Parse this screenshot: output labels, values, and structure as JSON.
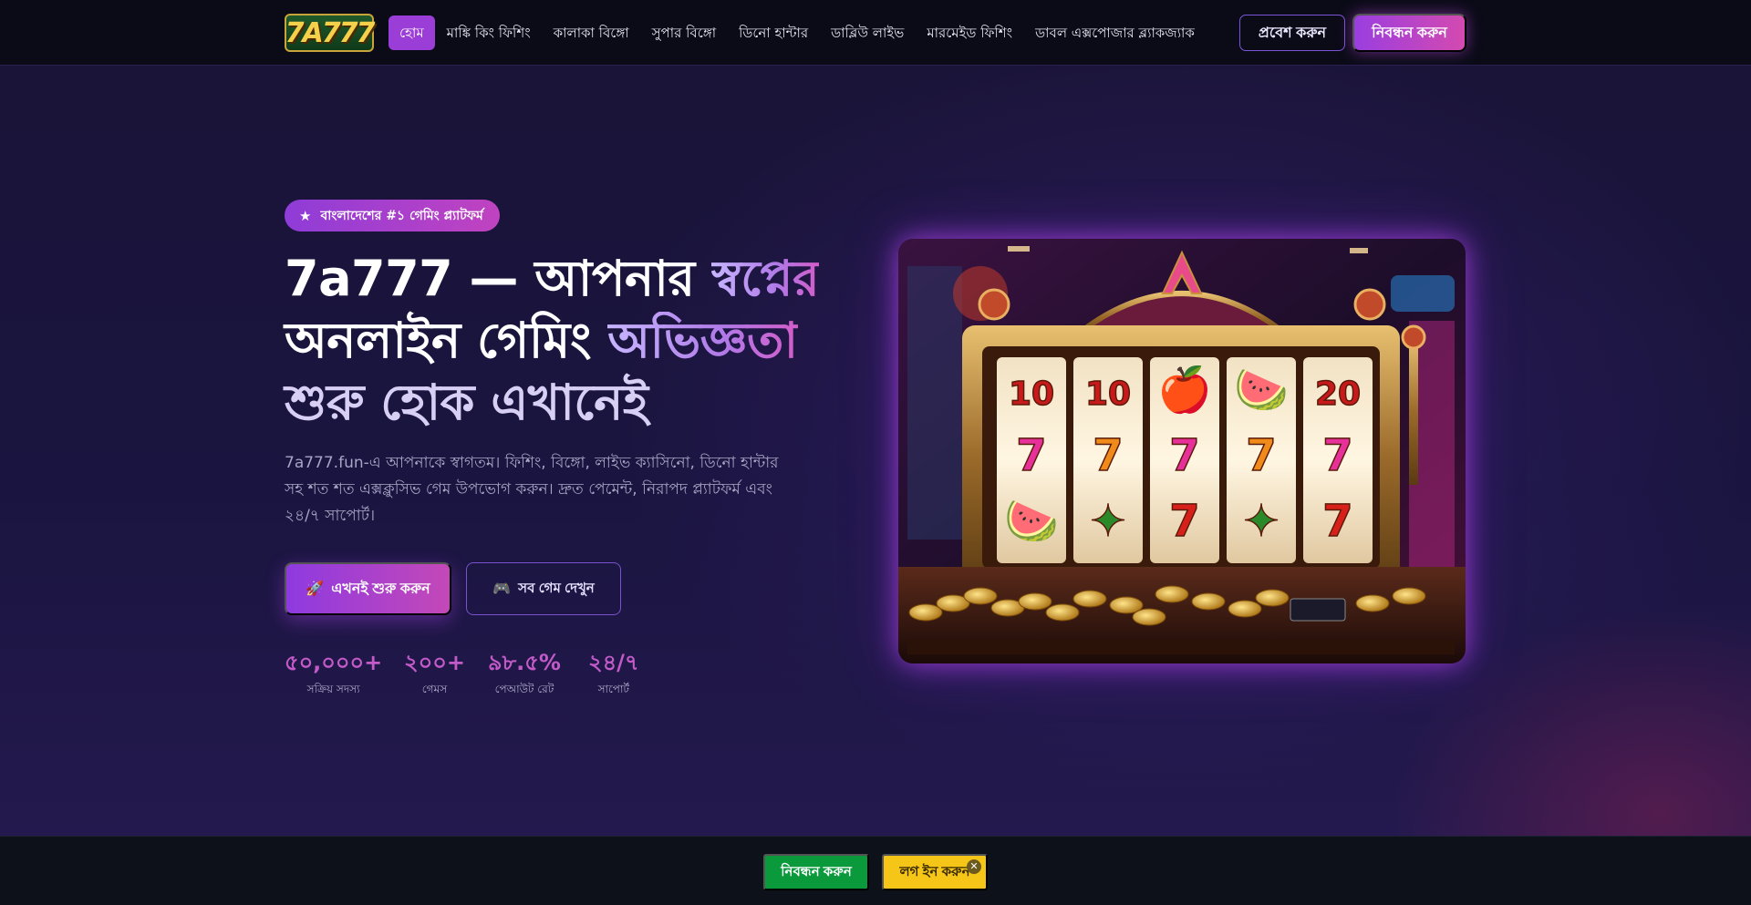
{
  "header": {
    "logo_text": "7A777",
    "nav": [
      {
        "label": "হোম",
        "active": true
      },
      {
        "label": "মাঙ্কি কিং ফিশিং"
      },
      {
        "label": "কালাকা বিঙ্গো"
      },
      {
        "label": "সুপার বিঙ্গো"
      },
      {
        "label": "ডিনো হান্টার"
      },
      {
        "label": "ডাব্লিউ লাইভ"
      },
      {
        "label": "মারমেইড ফিশিং"
      },
      {
        "label": "ডাবল এক্সপোজার ব্ল্যাকজ্যাক"
      }
    ],
    "login_label": "প্রবেশ করুন",
    "register_label": "নিবন্ধন করুন"
  },
  "hero": {
    "badge_icon": "star-icon",
    "badge_text": "বাংলাদেশের #১ গেমিং প্ল্যাটফর্ম",
    "headline": {
      "part1": "7a777 — আপনার ",
      "part2": "স্বপ্নের",
      "part3": "অনলাইন গেমিং ",
      "part4": "অভিজ্ঞতা",
      "part5": "শুরু হোক এখানেই"
    },
    "description": "7a777.fun-এ আপনাকে স্বাগতম। ফিশিং, বিঙ্গো, লাইভ ক্যাসিনো, ডিনো হান্টার সহ শত শত এক্সক্লুসিভ গেম উপভোগ করুন। দ্রুত পেমেন্ট, নিরাপদ প্ল্যাটফর্ম এবং ২৪/৭ সাপোর্ট।",
    "cta_primary": {
      "icon": "rocket-icon",
      "label": "এখনই শুরু করুন"
    },
    "cta_secondary": {
      "icon": "gamepad-icon",
      "label": "সব গেম দেখুন"
    },
    "stats": [
      {
        "value": "৫০,০০০+",
        "label": "সক্রিয় সদস্য"
      },
      {
        "value": "২০০+",
        "label": "গেমস"
      },
      {
        "value": "৯৮.৫%",
        "label": "পেআউট রেট"
      },
      {
        "value": "২৪/৭",
        "label": "সাপোর্ট"
      }
    ],
    "slot_reels": [
      [
        "10",
        "7",
        "🍉"
      ],
      [
        "10",
        "7",
        "✦"
      ],
      [
        "🍎",
        "7",
        "7"
      ],
      [
        "🍉",
        "7",
        "✦"
      ],
      [
        "20",
        "7",
        "7"
      ]
    ]
  },
  "bottom_bar": {
    "register_label": "নিবন্ধন করুন",
    "login_label": "লগ ইন করুন",
    "close_icon": "close-icon"
  },
  "colors": {
    "accent_purple": "#9b3ed8",
    "accent_pink": "#d44ab0",
    "stat_color": "#c25ac8",
    "green_button": "#0a9a3c",
    "yellow_button": "#f5c518"
  }
}
